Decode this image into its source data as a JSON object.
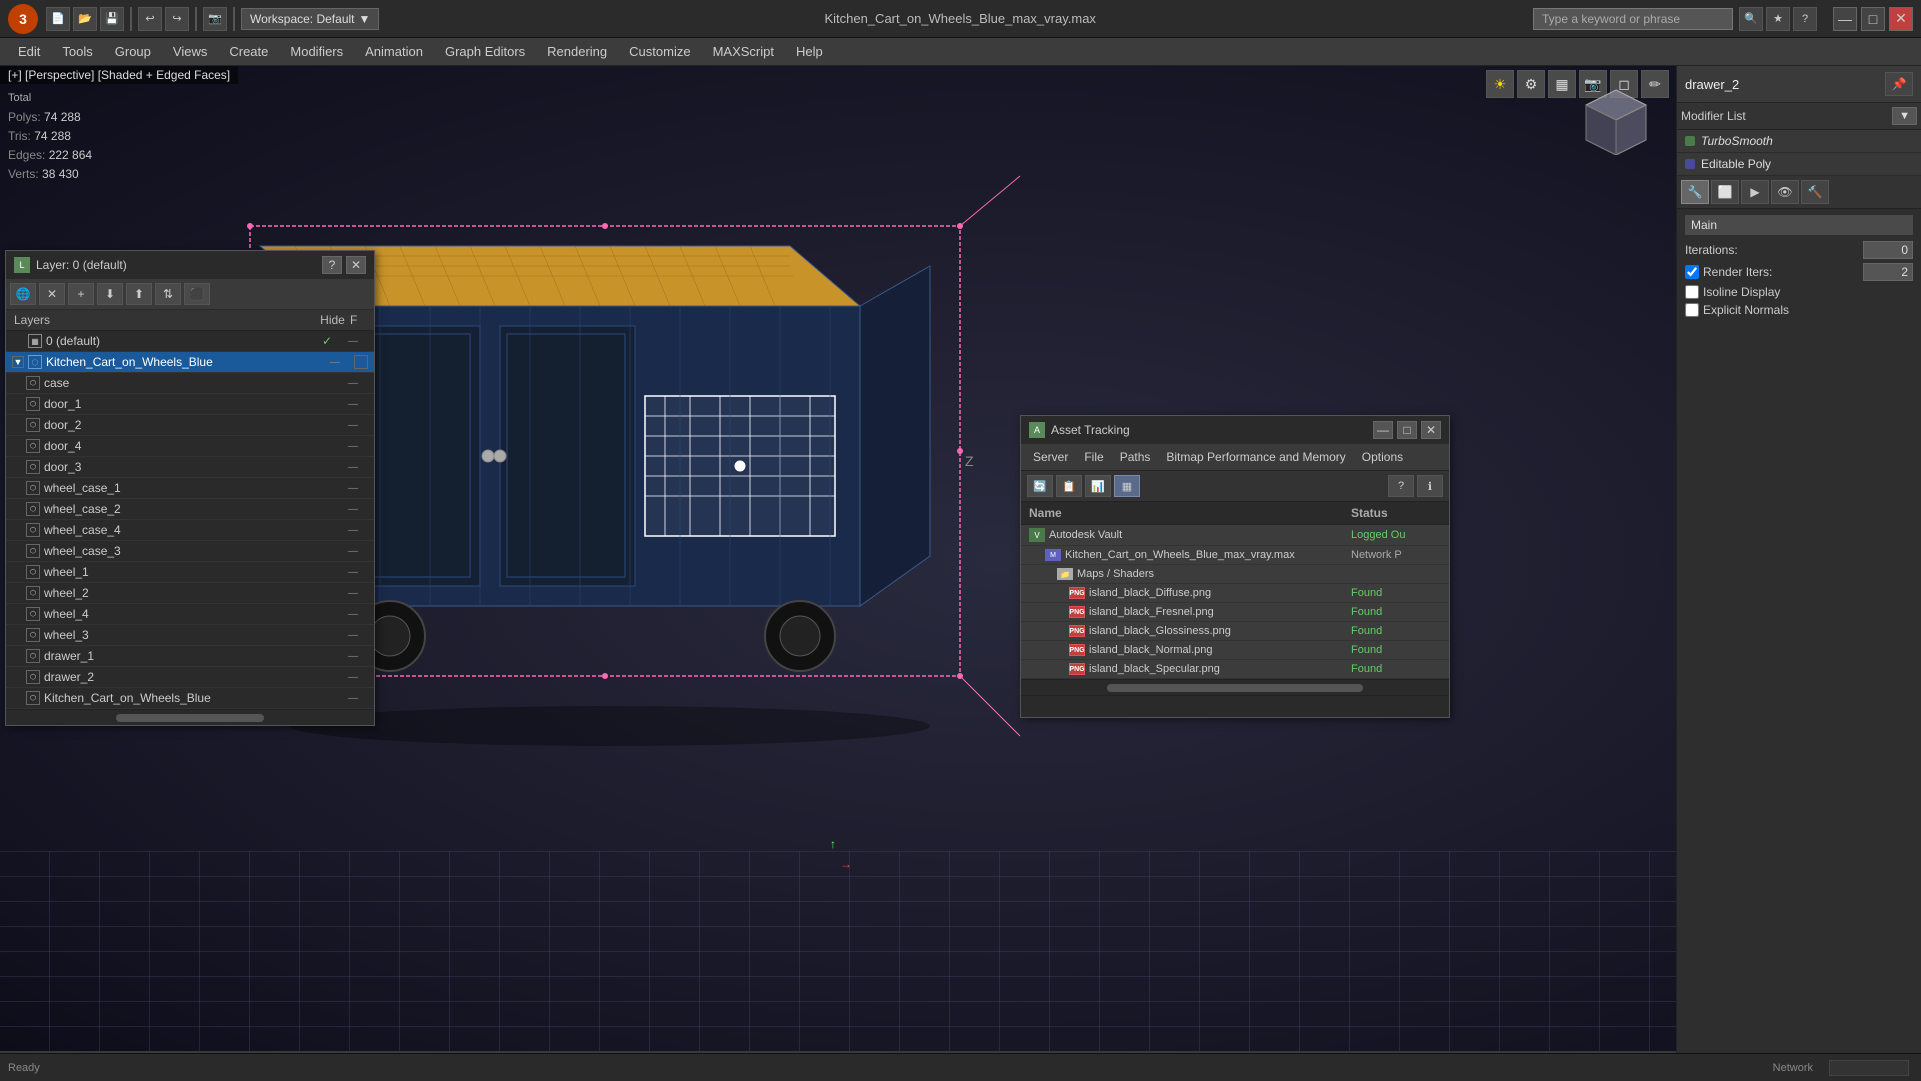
{
  "app": {
    "title": "Kitchen_Cart_on_Wheels_Blue_max_vray.max",
    "logo": "3",
    "workspace": "Workspace: Default"
  },
  "toolbar": {
    "icons": [
      "💾",
      "📂",
      "💾",
      "↩",
      "↪",
      "📷",
      "▼"
    ],
    "search_placeholder": "Type a keyword or phrase",
    "window_controls": [
      "—",
      "□",
      "✕"
    ]
  },
  "menubar": {
    "items": [
      "Edit",
      "Tools",
      "Group",
      "Views",
      "Create",
      "Modifiers",
      "Animation",
      "Graph Editors",
      "Rendering",
      "Customize",
      "MAXScript",
      "Help"
    ]
  },
  "viewport": {
    "label": "[+] [Perspective] [Shaded + Edged Faces]",
    "stats": {
      "polys_label": "Polys:",
      "polys_total_label": "Total",
      "polys_value": "74 288",
      "tris_label": "Tris:",
      "tris_value": "74 288",
      "edges_label": "Edges:",
      "edges_value": "222 864",
      "verts_label": "Verts:",
      "verts_value": "38 430"
    }
  },
  "right_panel": {
    "object_name": "drawer_2",
    "modifier_list_label": "Modifier List",
    "modifiers": [
      {
        "name": "TurboSmooth",
        "active": true
      },
      {
        "name": "Editable Poly",
        "active": true
      }
    ],
    "turbosmooth": {
      "section_label": "Main",
      "iterations_label": "Iterations:",
      "iterations_value": "0",
      "render_iters_label": "Render Iters:",
      "render_iters_value": "2",
      "isoline_label": "Isoline Display",
      "explicit_label": "Explicit Normals"
    }
  },
  "layer_dialog": {
    "title": "Layer: 0 (default)",
    "help_btn": "?",
    "close_btn": "✕",
    "columns": {
      "layers": "Layers",
      "hide": "Hide",
      "freeze": "F"
    },
    "layers": [
      {
        "indent": 0,
        "name": "0 (default)",
        "check": "✓",
        "selected": false,
        "has_expand": false
      },
      {
        "indent": 0,
        "name": "Kitchen_Cart_on_Wheels_Blue",
        "check": "",
        "selected": true,
        "has_expand": true
      },
      {
        "indent": 1,
        "name": "case",
        "check": "",
        "selected": false
      },
      {
        "indent": 1,
        "name": "door_1",
        "check": "",
        "selected": false
      },
      {
        "indent": 1,
        "name": "door_2",
        "check": "",
        "selected": false
      },
      {
        "indent": 1,
        "name": "door_4",
        "check": "",
        "selected": false
      },
      {
        "indent": 1,
        "name": "door_3",
        "check": "",
        "selected": false
      },
      {
        "indent": 1,
        "name": "wheel_case_1",
        "check": "",
        "selected": false
      },
      {
        "indent": 1,
        "name": "wheel_case_2",
        "check": "",
        "selected": false
      },
      {
        "indent": 1,
        "name": "wheel_case_4",
        "check": "",
        "selected": false
      },
      {
        "indent": 1,
        "name": "wheel_case_3",
        "check": "",
        "selected": false
      },
      {
        "indent": 1,
        "name": "wheel_1",
        "check": "",
        "selected": false
      },
      {
        "indent": 1,
        "name": "wheel_2",
        "check": "",
        "selected": false
      },
      {
        "indent": 1,
        "name": "wheel_4",
        "check": "",
        "selected": false
      },
      {
        "indent": 1,
        "name": "wheel_3",
        "check": "",
        "selected": false
      },
      {
        "indent": 1,
        "name": "drawer_1",
        "check": "",
        "selected": false
      },
      {
        "indent": 1,
        "name": "drawer_2",
        "check": "",
        "selected": false
      },
      {
        "indent": 1,
        "name": "Kitchen_Cart_on_Wheels_Blue",
        "check": "",
        "selected": false
      }
    ]
  },
  "asset_dialog": {
    "title": "Asset Tracking",
    "menu_items": [
      "Server",
      "File",
      "Paths",
      "Bitmap Performance and Memory",
      "Options"
    ],
    "columns": {
      "name": "Name",
      "status": "Status"
    },
    "assets": [
      {
        "type": "vault",
        "name": "Autodesk Vault",
        "status": "Logged Ou",
        "indent": 0
      },
      {
        "type": "max",
        "name": "Kitchen_Cart_on_Wheels_Blue_max_vray.max",
        "status": "Network P",
        "indent": 1
      },
      {
        "type": "folder",
        "name": "Maps / Shaders",
        "status": "",
        "indent": 2
      },
      {
        "type": "png",
        "name": "island_black_Diffuse.png",
        "status": "Found",
        "indent": 3
      },
      {
        "type": "png",
        "name": "island_black_Fresnel.png",
        "status": "Found",
        "indent": 3
      },
      {
        "type": "png",
        "name": "island_black_Glossiness.png",
        "status": "Found",
        "indent": 3
      },
      {
        "type": "png",
        "name": "island_black_Normal.png",
        "status": "Found",
        "indent": 3
      },
      {
        "type": "png",
        "name": "island_black_Specular.png",
        "status": "Found",
        "indent": 3
      }
    ]
  },
  "statusbar": {
    "text": "Network"
  }
}
